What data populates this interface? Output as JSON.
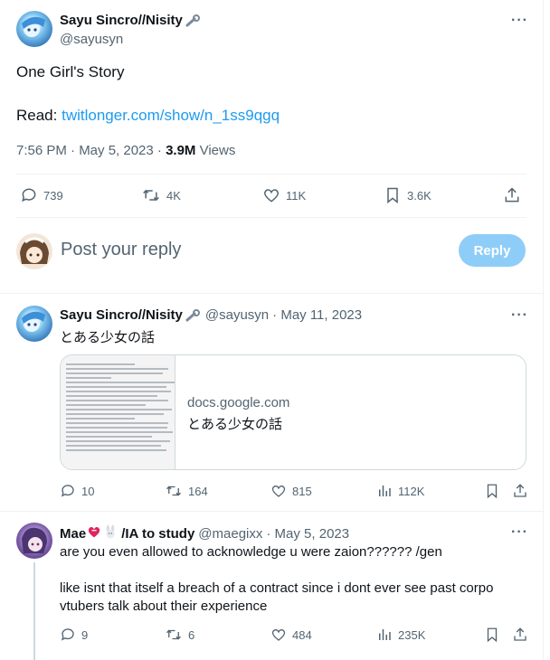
{
  "main_tweet": {
    "author_name": "Sayu Sincro//Nisity",
    "author_badge_icon": "wrench-icon",
    "handle": "@sayusyn",
    "text_line1": "One Girl's Story",
    "read_label": "Read:",
    "link": "twitlonger.com/show/n_1ss9qgq",
    "timestamp": "7:56 PM · May 5, 2023 ·",
    "views_count": "3.9M",
    "views_label": "Views",
    "actions": {
      "replies": "739",
      "retweets": "4K",
      "likes": "11K",
      "bookmarks": "3.6K"
    }
  },
  "composer": {
    "placeholder": "Post your reply",
    "reply_button": "Reply"
  },
  "reply1": {
    "author_name": "Sayu Sincro//Nisity",
    "handle": "@sayusyn",
    "date": "· May 11, 2023",
    "text": "とある少女の話",
    "card": {
      "domain": "docs.google.com",
      "title": "とある少女の話"
    },
    "actions": {
      "replies": "10",
      "retweets": "164",
      "likes": "815",
      "views": "112K"
    }
  },
  "reply2": {
    "author_name": "Mae",
    "author_suffix": "/IA to study",
    "handle": "@maegixx",
    "date": "· May 5, 2023",
    "text1": "are you even allowed to acknowledge u were zaion?????? /gen",
    "text2": "like isnt that itself a breach of a contract since i dont ever see past corpo vtubers talk about their experience",
    "actions": {
      "replies": "9",
      "retweets": "6",
      "likes": "484",
      "views": "235K"
    }
  },
  "colors": {
    "accent": "#1d9bf0",
    "muted": "#536471",
    "reply_button": "#8ecdf7",
    "heart_emoji": "#e0245e"
  }
}
